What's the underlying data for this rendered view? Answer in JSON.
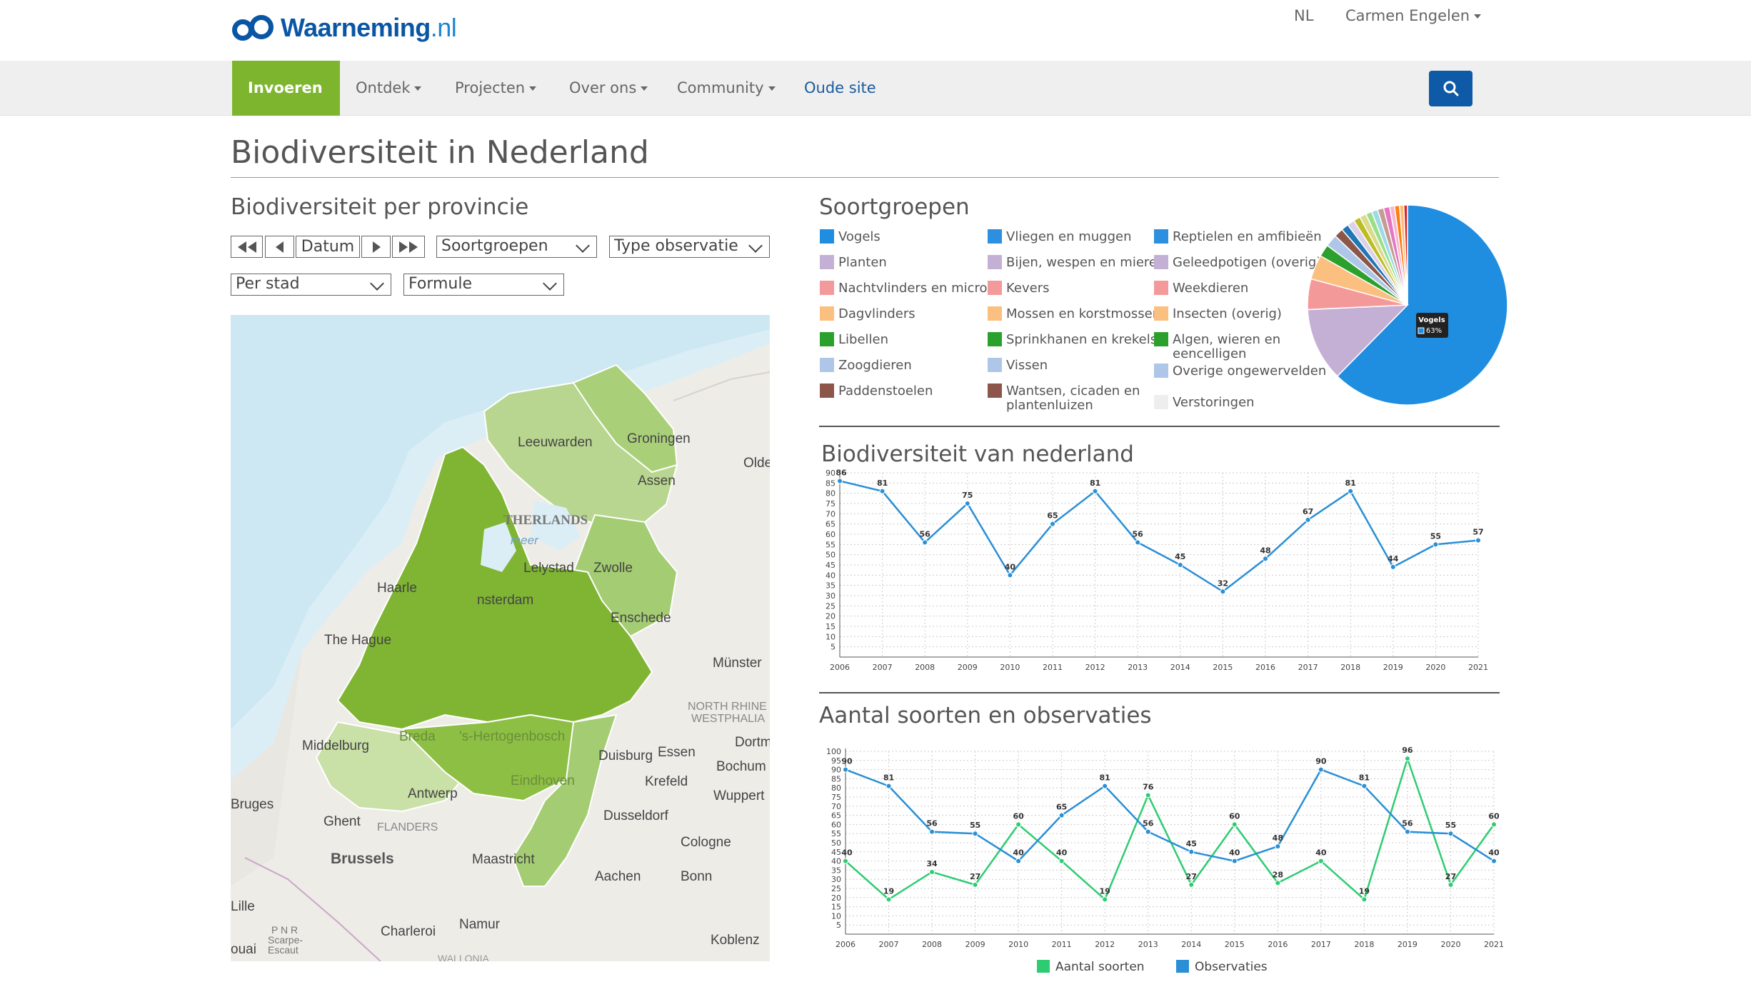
{
  "header": {
    "logo_text": "Waarneming",
    "logo_suffix": ".nl",
    "lang": "NL",
    "user": "Carmen Engelen"
  },
  "nav": {
    "items": [
      "Invoeren",
      "Ontdek",
      "Projecten",
      "Over ons",
      "Community"
    ],
    "old_site": "Oude site"
  },
  "page_title": "Biodiversiteit in Nederland",
  "left": {
    "title": "Biodiversiteit per provincie",
    "date_label": "Datum",
    "filter_group": "Soortgroepen",
    "filter_type": "Type observatie",
    "filter_scope": "Per stad",
    "filter_formula": "Formule"
  },
  "map": {
    "labels": [
      "Leeuwarden",
      "Groningen",
      "Assen",
      "THERLANDS",
      "meer",
      "Lelystad",
      "Zwolle",
      "Haarle",
      "nsterdam",
      "Enschede",
      "The Hague",
      "Münster",
      "NORTH RHINE",
      "WESTPHALIA",
      "Middelburg",
      "Breda",
      "'s-Hertogenbosch",
      "Eindhoven",
      "Duisburg",
      "Essen",
      "Dortm",
      "Bochum",
      "Krefeld",
      "Wuppert",
      "Bruges",
      "Antwerp",
      "Ghent",
      "FLANDERS",
      "Dusseldorf",
      "Brussels",
      "Maastricht",
      "Cologne",
      "Aachen",
      "Bonn",
      "Lille",
      "Charleroi",
      "Namur",
      "Koblenz",
      "Olde",
      "P N R",
      "Scarpe-",
      "Escaut",
      "ouai",
      "WALLONIA"
    ]
  },
  "soortgroepen": {
    "title": "Soortgroepen",
    "legend": [
      {
        "label": "Vogels",
        "color": "#1f8de0"
      },
      {
        "label": "Vliegen en muggen",
        "color": "#2d8fe0"
      },
      {
        "label": "Reptielen en amfibieën",
        "color": "#2d8fe0"
      },
      {
        "label": "Planten",
        "color": "#c5b0d5"
      },
      {
        "label": "Bijen, wespen en mieren",
        "color": "#c5b0d5"
      },
      {
        "label": "Geleedpotigen (overig)",
        "color": "#c5b0d5"
      },
      {
        "label": "Nachtvlinders en micro's",
        "color": "#f4999a"
      },
      {
        "label": "Kevers",
        "color": "#f4999a"
      },
      {
        "label": "Weekdieren",
        "color": "#f4999a"
      },
      {
        "label": "Dagvlinders",
        "color": "#fbbf80"
      },
      {
        "label": "Mossen en korstmossen",
        "color": "#fbbf80"
      },
      {
        "label": "Insecten (overig)",
        "color": "#fbbf80"
      },
      {
        "label": "Libellen",
        "color": "#2ca02c"
      },
      {
        "label": "Sprinkhanen en krekels",
        "color": "#2ca02c"
      },
      {
        "label": "Algen, wieren en eencelligen",
        "color": "#2ca02c"
      },
      {
        "label": "Zoogdieren",
        "color": "#aec7e8"
      },
      {
        "label": "Vissen",
        "color": "#aec7e8"
      },
      {
        "label": "Overige ongewervelden",
        "color": "#aec7e8"
      },
      {
        "label": "Paddenstoelen",
        "color": "#8c564b"
      },
      {
        "label": "Wantsen, cicaden en plantenluizen",
        "color": "#8c564b"
      },
      {
        "label": "Verstoringen",
        "color": "#eeeeee"
      }
    ],
    "tooltip_title": "Vogels",
    "tooltip_value": "63%"
  },
  "chart_data": [
    {
      "type": "pie",
      "title": "Soortgroepen",
      "slices": [
        {
          "name": "Vogels",
          "value": 63,
          "color": "#1f8de0"
        },
        {
          "name": "Planten",
          "value": 12,
          "color": "#c5b0d5"
        },
        {
          "name": "Nachtvlinders en micro's",
          "value": 5,
          "color": "#f4999a"
        },
        {
          "name": "Dagvlinders",
          "value": 4,
          "color": "#fbbf80"
        },
        {
          "name": "Libellen",
          "value": 2,
          "color": "#2ca02c"
        },
        {
          "name": "Zoogdieren",
          "value": 2,
          "color": "#aec7e8"
        },
        {
          "name": "Paddenstoelen",
          "value": 1.5,
          "color": "#8c564b"
        },
        {
          "name": "Vliegen en muggen",
          "value": 1.2,
          "color": "#1f77b4"
        },
        {
          "name": "Bijen, wespen en mieren",
          "value": 1.2,
          "color": "#dcd0ea"
        },
        {
          "name": "Kevers",
          "value": 1.1,
          "color": "#bcbd22"
        },
        {
          "name": "Mossen en korstmossen",
          "value": 1.1,
          "color": "#dbdb8d"
        },
        {
          "name": "Sprinkhanen en krekels",
          "value": 1,
          "color": "#98df8a"
        },
        {
          "name": "Vissen",
          "value": 1,
          "color": "#9edae5"
        },
        {
          "name": "Wantsen, cicaden en plantenluizen",
          "value": 1,
          "color": "#c49c94"
        },
        {
          "name": "Reptielen en amfibieën",
          "value": 1,
          "color": "#e377c2"
        },
        {
          "name": "Geleedpotigen (overig)",
          "value": 0.8,
          "color": "#f7b6d2"
        },
        {
          "name": "Weekdieren",
          "value": 0.8,
          "color": "#ff7f0e"
        },
        {
          "name": "Insecten (overig)",
          "value": 0.7,
          "color": "#ffbb78"
        },
        {
          "name": "Algen, wieren en eencelligen",
          "value": 0.6,
          "color": "#d62728"
        }
      ]
    },
    {
      "type": "line",
      "title": "Biodiversiteit van nederland",
      "x": [
        "2006",
        "2007",
        "2008",
        "2009",
        "2010",
        "2011",
        "2012",
        "2013",
        "2014",
        "2015",
        "2016",
        "2017",
        "2018",
        "2019",
        "2020",
        "2021"
      ],
      "series": [
        {
          "values": [
            86,
            81,
            56,
            75,
            40,
            65,
            81,
            56,
            45,
            32,
            48,
            67,
            81,
            44,
            55,
            57
          ],
          "color": "#2a8fd5"
        }
      ],
      "ylim": [
        0,
        90
      ],
      "yticks": [
        5,
        10,
        15,
        20,
        25,
        30,
        35,
        40,
        45,
        50,
        55,
        60,
        65,
        70,
        75,
        80,
        85,
        90
      ],
      "grid": true
    },
    {
      "type": "line",
      "title": "Aantal soorten en observaties",
      "x": [
        "2006",
        "2007",
        "2008",
        "2009",
        "2010",
        "2011",
        "2012",
        "2013",
        "2014",
        "2015",
        "2016",
        "2017",
        "2018",
        "2019",
        "2020",
        "2021"
      ],
      "series": [
        {
          "name": "Aantal soorten",
          "values": [
            40,
            19,
            34,
            27,
            60,
            40,
            19,
            76,
            27,
            60,
            28,
            40,
            19,
            96,
            27,
            60
          ],
          "color": "#2ecc71"
        },
        {
          "name": "Observaties",
          "values": [
            90,
            81,
            56,
            55,
            40,
            65,
            81,
            56,
            45,
            40,
            48,
            90,
            81,
            56,
            55,
            40
          ],
          "color": "#2a8fd5"
        }
      ],
      "ylim": [
        0,
        100
      ],
      "yticks": [
        5,
        10,
        15,
        20,
        25,
        30,
        35,
        40,
        45,
        50,
        55,
        60,
        65,
        70,
        75,
        80,
        85,
        90,
        95,
        100
      ],
      "legend": "bottom",
      "grid": true
    }
  ]
}
